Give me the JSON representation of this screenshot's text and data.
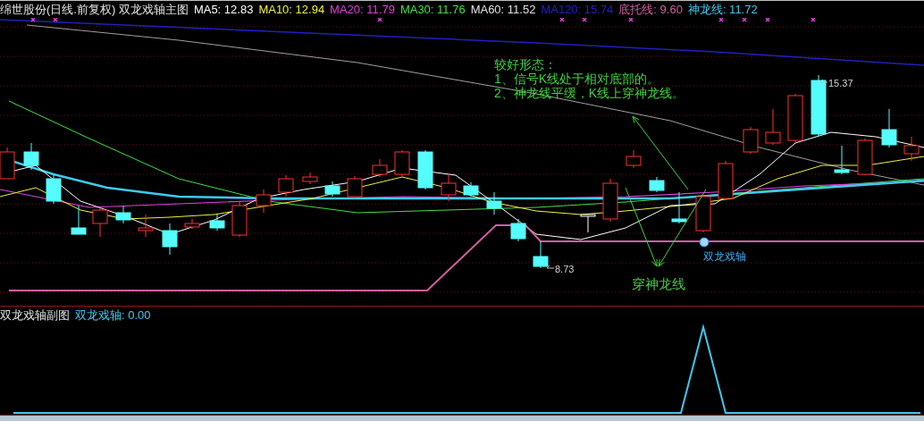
{
  "main_chart": {
    "title": "绵世股份(日线.前复权) 双龙戏轴主图",
    "legend": [
      {
        "label": "MA5: 12.83",
        "color": "#ffffff"
      },
      {
        "label": "MA10: 12.94",
        "color": "#f0f040"
      },
      {
        "label": "MA20: 11.79",
        "color": "#e040e0"
      },
      {
        "label": "MA30: 11.76",
        "color": "#40e040"
      },
      {
        "label": "MA60: 11.52",
        "color": "#e0e0e0"
      },
      {
        "label": "MA120: 15.74",
        "color": "#2020c0"
      },
      {
        "label": "底托线: 9.60",
        "color": "#d060a0"
      },
      {
        "label": "神龙线: 11.72",
        "color": "#40c8f0"
      }
    ],
    "annotation": {
      "heading": "较好形态：",
      "lines": [
        "1、信号K线处于相对底部的。",
        "2、神龙线平缓，K线上穿神龙线。"
      ]
    },
    "callout": "穿神龙线",
    "signal_label": "双龙戏轴",
    "high_label": "15.37",
    "low_label": "8.73"
  },
  "sub_chart": {
    "title": "双龙戏轴副图",
    "legend": [
      {
        "label": "双龙戏轴: 0.00",
        "color": "#40c8f0"
      }
    ]
  }
}
